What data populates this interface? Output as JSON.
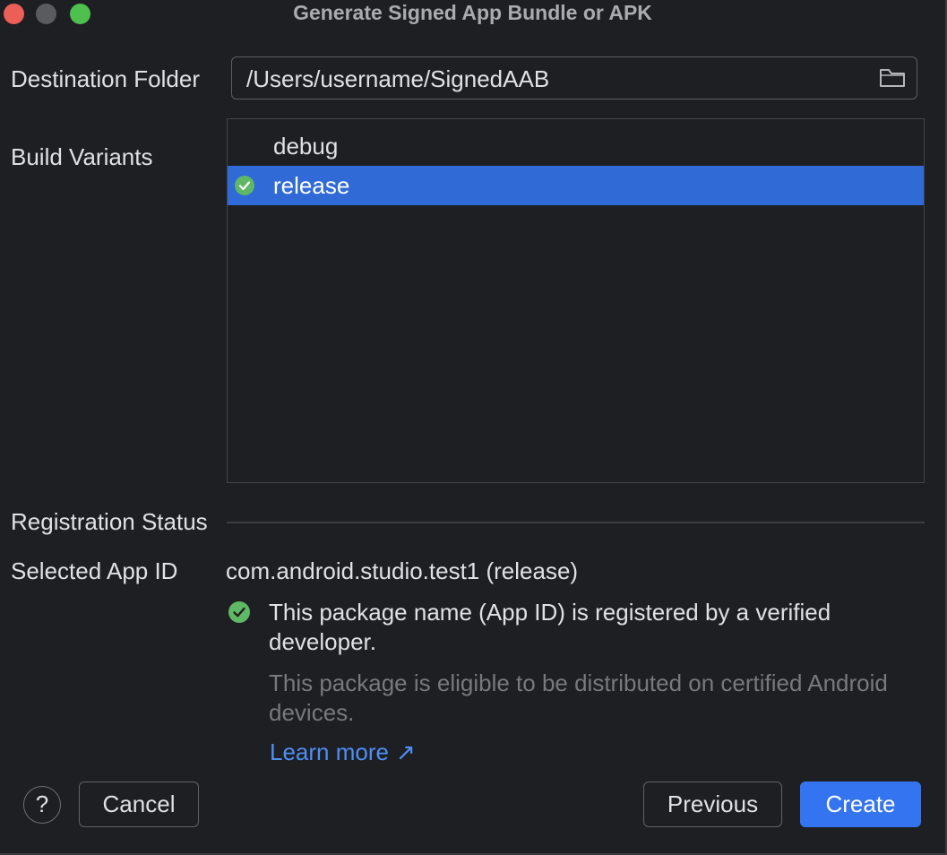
{
  "window": {
    "title": "Generate Signed App Bundle or APK"
  },
  "destination": {
    "label": "Destination Folder",
    "value": "/Users/username/SignedAAB",
    "icon": "folder-icon"
  },
  "build_variants": {
    "label": "Build Variants",
    "items": [
      {
        "label": "debug",
        "selected": false
      },
      {
        "label": "release",
        "selected": true
      }
    ]
  },
  "registration": {
    "section_label": "Registration Status",
    "app_id_label": "Selected App ID",
    "app_id_value": "com.android.studio.test1 (release)",
    "status_main": "This package name (App ID) is registered by a verified developer.",
    "status_sub": "This package is eligible to be distributed on certified Android devices.",
    "learn_more": "Learn more",
    "learn_more_arrow": "↗"
  },
  "footer": {
    "help": "?",
    "cancel": "Cancel",
    "previous": "Previous",
    "create": "Create"
  },
  "colors": {
    "background": "#1e1f22",
    "selection": "#2f6ad6",
    "primary_button": "#3574f0",
    "success": "#5fb865",
    "link": "#4e8ff4"
  }
}
